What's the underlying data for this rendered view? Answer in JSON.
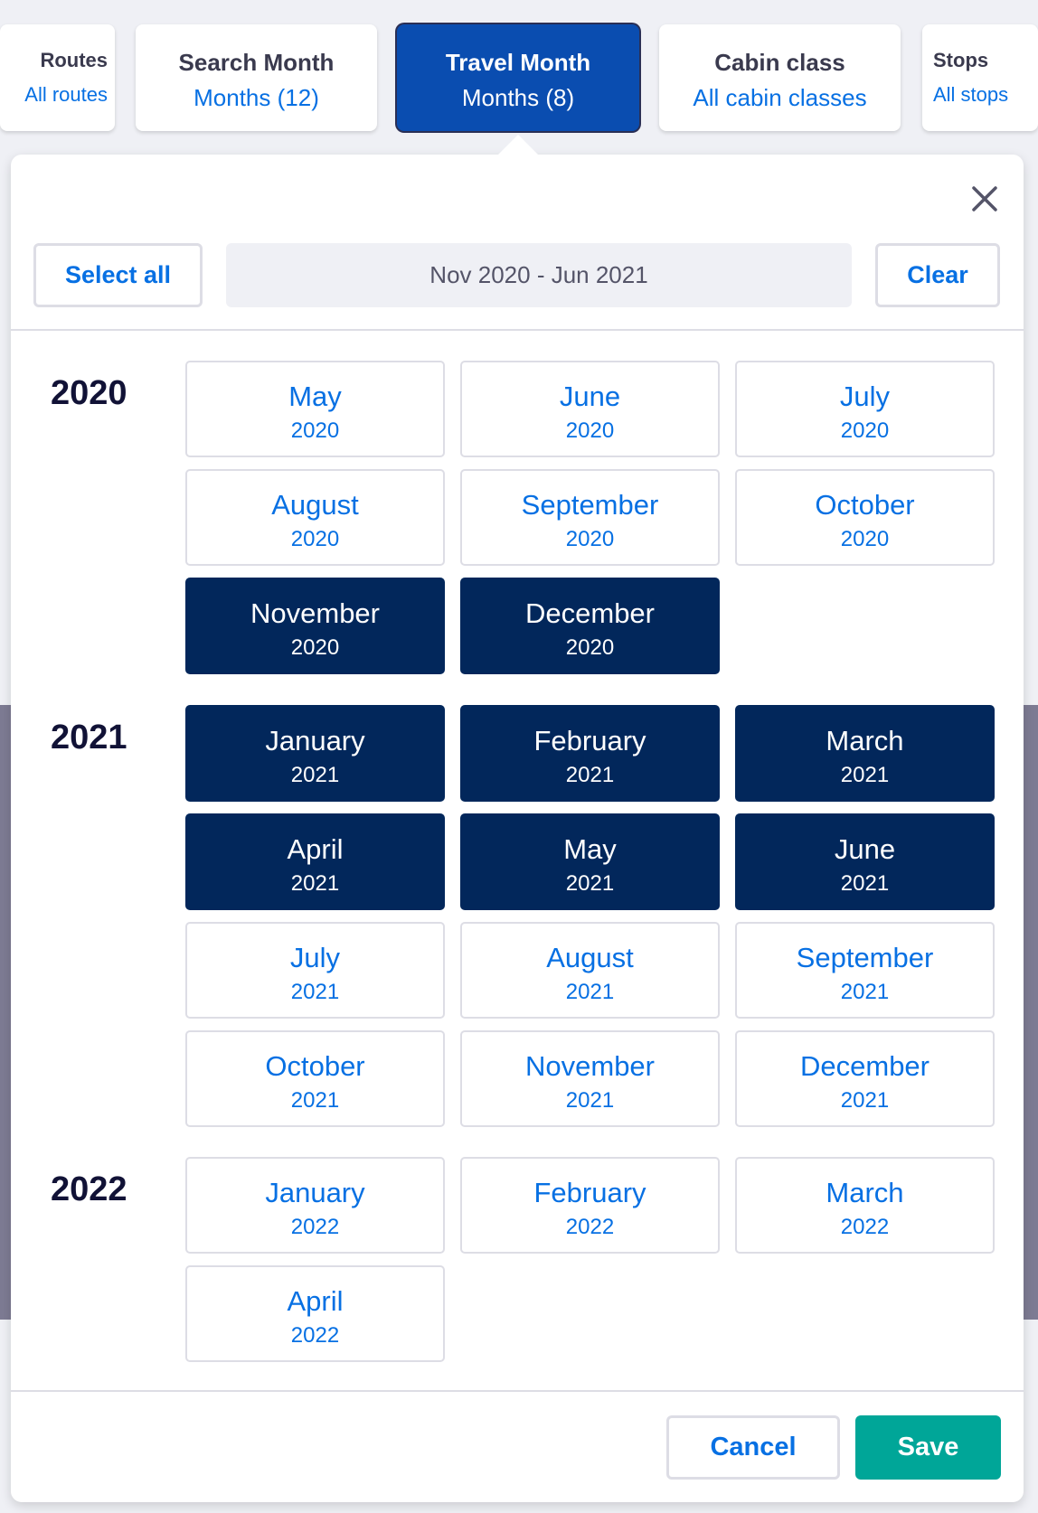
{
  "tabs": [
    {
      "title": "Routes",
      "value": "All routes",
      "active": false
    },
    {
      "title": "Search Month",
      "value": "Months (12)",
      "active": false
    },
    {
      "title": "Travel Month",
      "value": "Months (8)",
      "active": true
    },
    {
      "title": "Cabin class",
      "value": "All cabin classes",
      "active": false
    },
    {
      "title": "Stops",
      "value": "All stops",
      "active": false
    }
  ],
  "panel": {
    "select_all_label": "Select all",
    "range_text": "Nov 2020 - Jun 2021",
    "clear_label": "Clear",
    "cancel_label": "Cancel",
    "save_label": "Save",
    "close_icon": "close-icon"
  },
  "colors": {
    "accent": "#0770e3",
    "selected_month": "#02275b",
    "active_tab": "#0a4db0",
    "save": "#00a698"
  },
  "years": [
    {
      "year": "2020",
      "months": [
        {
          "name": "May",
          "year": "2020",
          "selected": false
        },
        {
          "name": "June",
          "year": "2020",
          "selected": false
        },
        {
          "name": "July",
          "year": "2020",
          "selected": false
        },
        {
          "name": "August",
          "year": "2020",
          "selected": false
        },
        {
          "name": "September",
          "year": "2020",
          "selected": false
        },
        {
          "name": "October",
          "year": "2020",
          "selected": false
        },
        {
          "name": "November",
          "year": "2020",
          "selected": true
        },
        {
          "name": "December",
          "year": "2020",
          "selected": true
        }
      ]
    },
    {
      "year": "2021",
      "months": [
        {
          "name": "January",
          "year": "2021",
          "selected": true
        },
        {
          "name": "February",
          "year": "2021",
          "selected": true
        },
        {
          "name": "March",
          "year": "2021",
          "selected": true
        },
        {
          "name": "April",
          "year": "2021",
          "selected": true
        },
        {
          "name": "May",
          "year": "2021",
          "selected": true
        },
        {
          "name": "June",
          "year": "2021",
          "selected": true
        },
        {
          "name": "July",
          "year": "2021",
          "selected": false
        },
        {
          "name": "August",
          "year": "2021",
          "selected": false
        },
        {
          "name": "September",
          "year": "2021",
          "selected": false
        },
        {
          "name": "October",
          "year": "2021",
          "selected": false
        },
        {
          "name": "November",
          "year": "2021",
          "selected": false
        },
        {
          "name": "December",
          "year": "2021",
          "selected": false
        }
      ]
    },
    {
      "year": "2022",
      "months": [
        {
          "name": "January",
          "year": "2022",
          "selected": false
        },
        {
          "name": "February",
          "year": "2022",
          "selected": false
        },
        {
          "name": "March",
          "year": "2022",
          "selected": false
        },
        {
          "name": "April",
          "year": "2022",
          "selected": false
        }
      ]
    }
  ]
}
